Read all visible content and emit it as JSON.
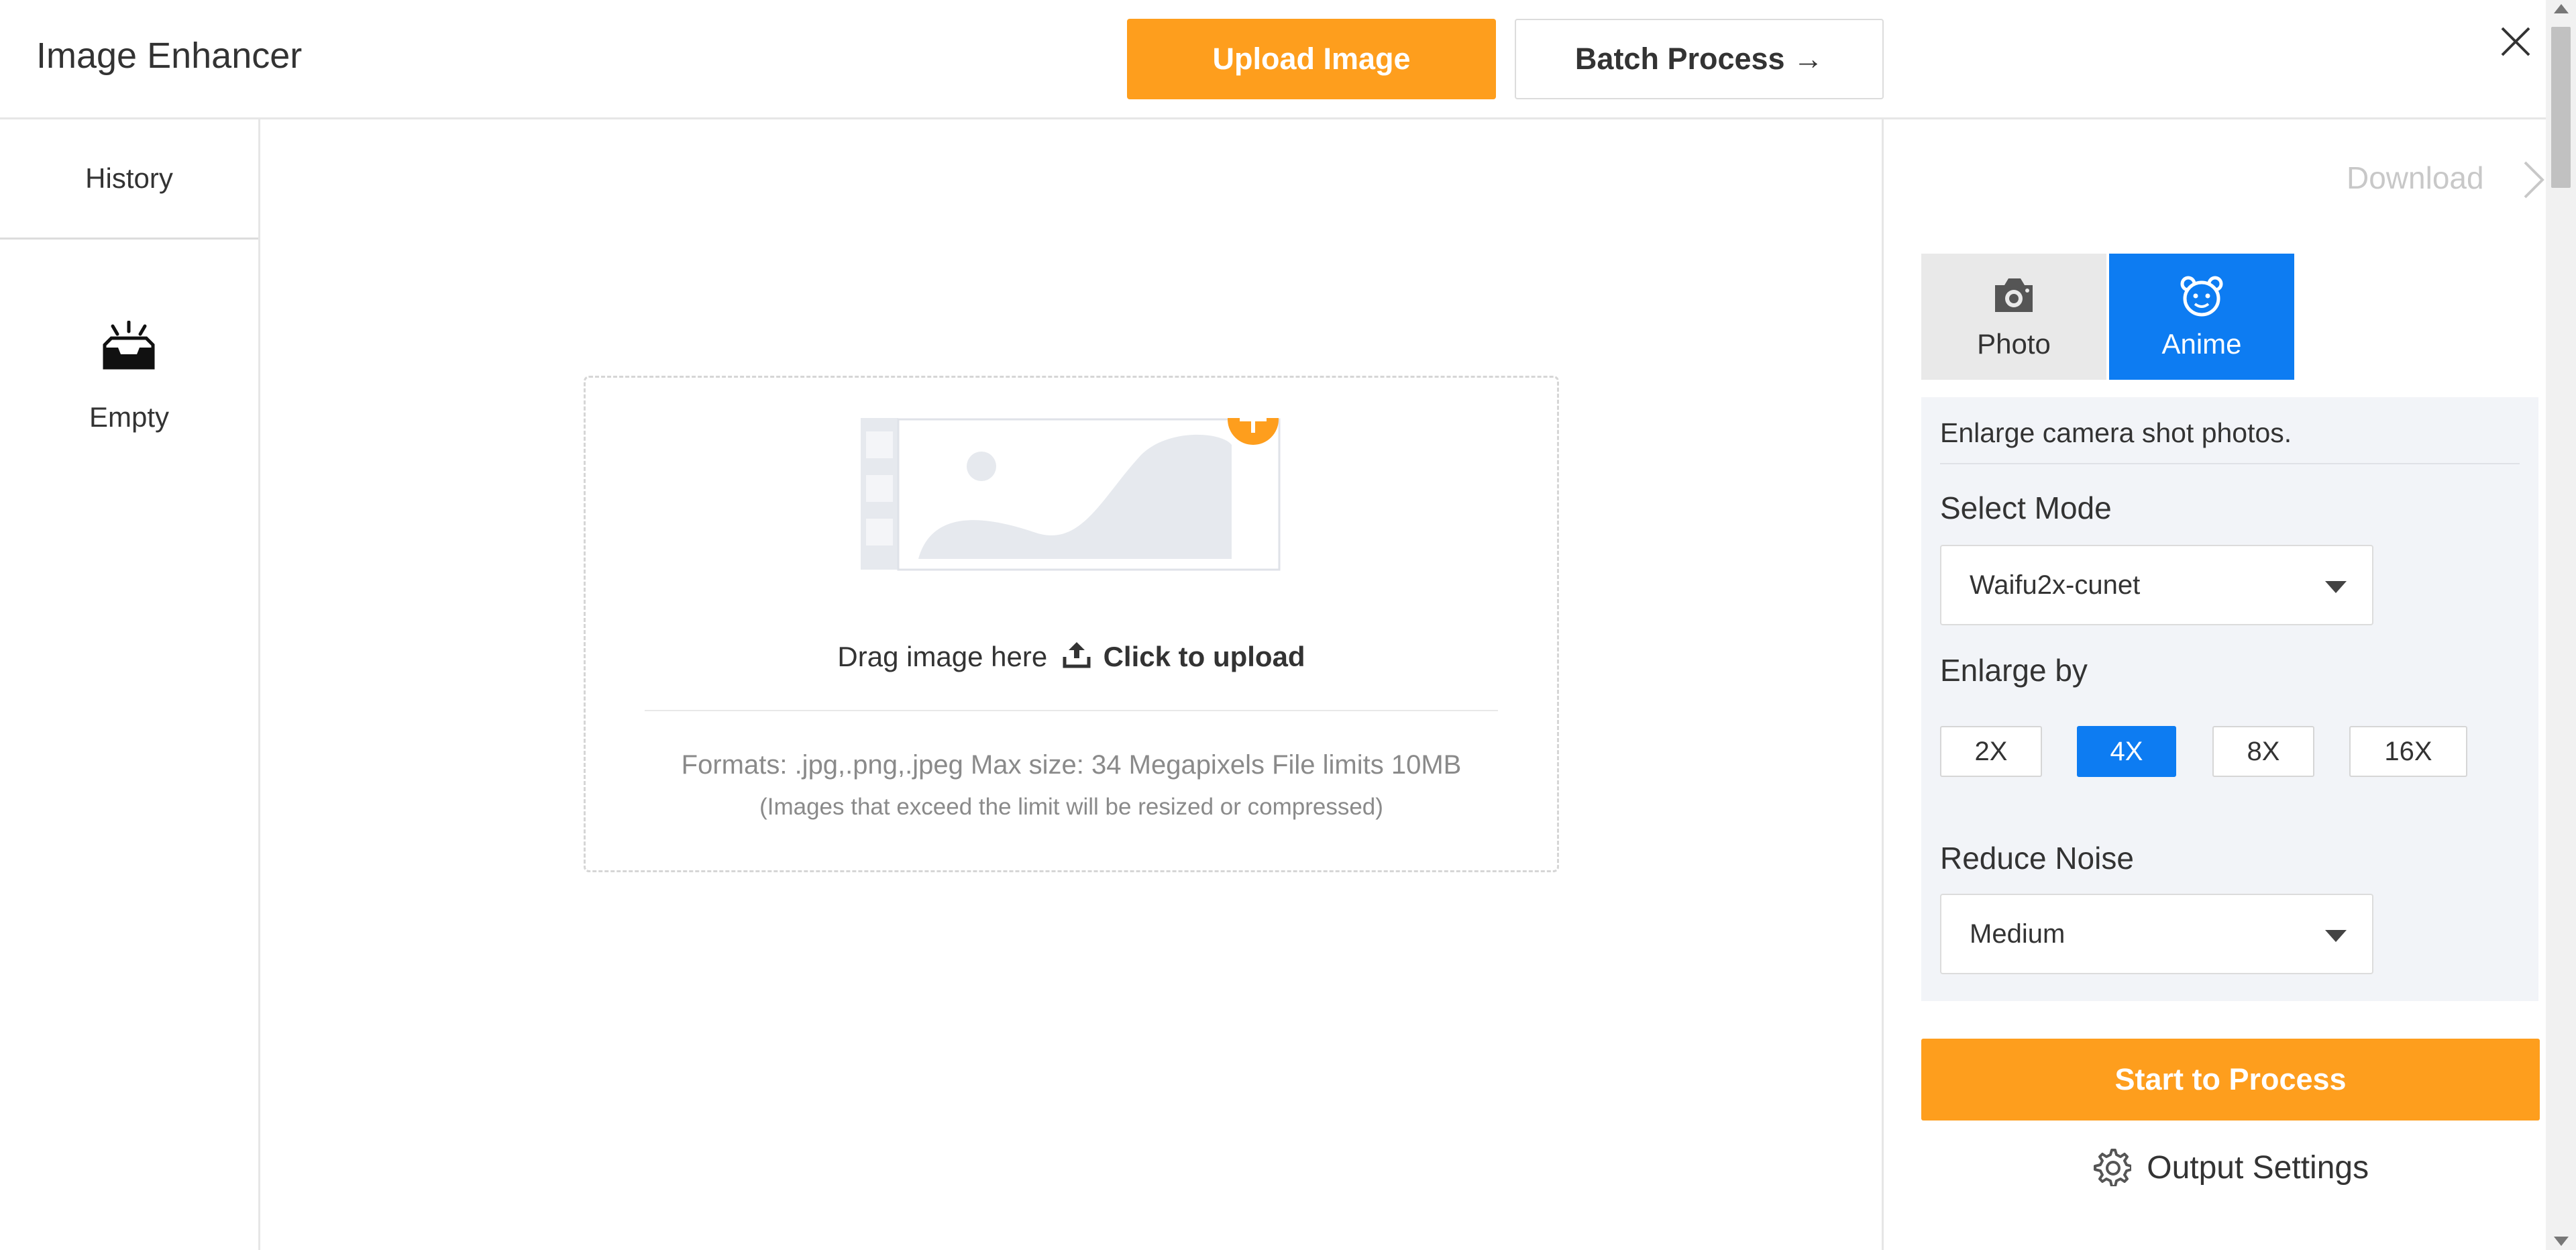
{
  "header": {
    "title": "Image Enhancer",
    "upload_label": "Upload Image",
    "batch_label": "Batch Process →"
  },
  "sidebar": {
    "history_label": "History",
    "empty_label": "Empty"
  },
  "dropzone": {
    "drag_text": "Drag image here",
    "click_text": "Click to upload",
    "formats": "Formats: .jpg,.png,.jpeg Max size: 34 Megapixels File limits 10MB",
    "note": "(Images that exceed the limit will be resized or compressed)"
  },
  "panel": {
    "download_label": "Download",
    "tabs": [
      {
        "label": "Photo",
        "icon": "camera-icon",
        "active": false
      },
      {
        "label": "Anime",
        "icon": "bear-face-icon",
        "active": true
      }
    ],
    "description": "Enlarge camera shot photos.",
    "select_mode_label": "Select Mode",
    "select_mode_value": "Waifu2x-cunet",
    "enlarge_label": "Enlarge by",
    "scales": [
      "2X",
      "4X",
      "8X",
      "16X"
    ],
    "active_scale": "4X",
    "reduce_noise_label": "Reduce Noise",
    "reduce_noise_value": "Medium",
    "start_label": "Start to Process",
    "output_settings_label": "Output Settings"
  },
  "colors": {
    "accent_orange": "#fe9e1d",
    "accent_blue": "#0d7cf2"
  }
}
